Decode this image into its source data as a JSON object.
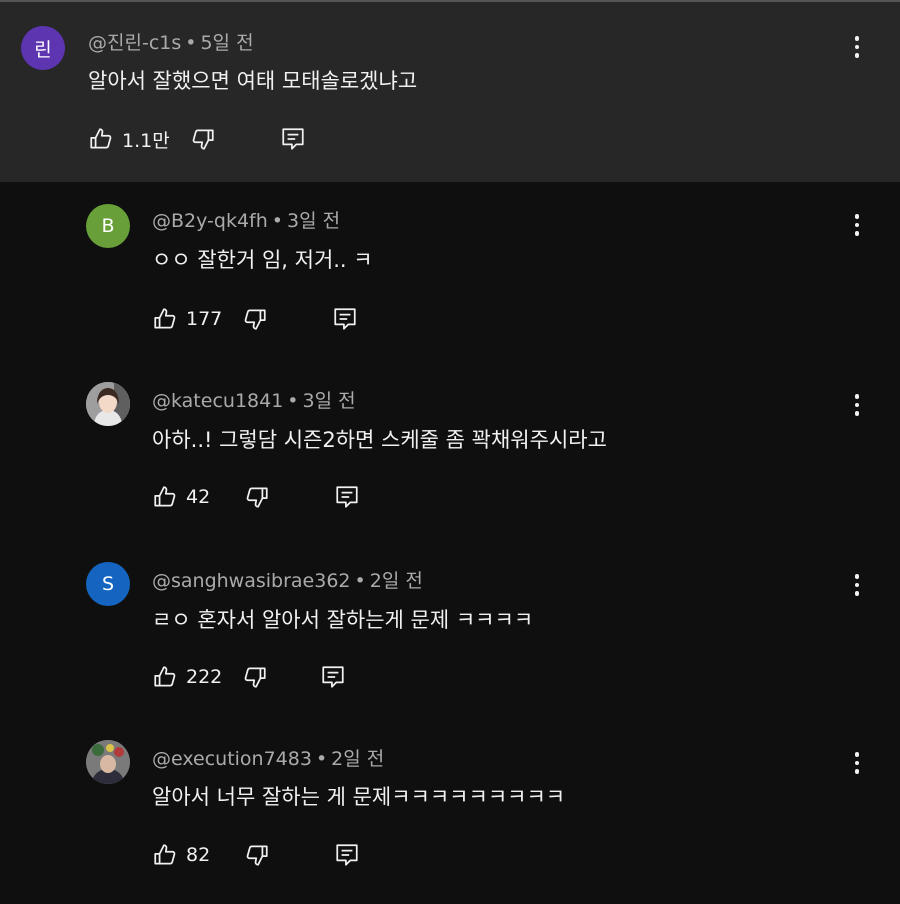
{
  "comments": [
    {
      "avatar_text": "린",
      "avatar_color": "#5e35b1",
      "author": "@진린-c1s",
      "time": "5일 전",
      "text": "알아서 잘했으면 여태 모태솔로겠냐고",
      "likes": "1.1만"
    },
    {
      "avatar_text": "B",
      "avatar_color": "#689f38",
      "author": "@B2y-qk4fh",
      "time": "3일 전",
      "text": "ㅇㅇ 잘한거 임, 저거.. ㅋ",
      "likes": "177"
    },
    {
      "avatar_text": "",
      "avatar_color": "#cfcfcf",
      "author": "@katecu1841",
      "time": "3일 전",
      "text": "아하..! 그렇담 시즌2하면 스케줄 좀 꽉채워주시라고",
      "likes": "42"
    },
    {
      "avatar_text": "S",
      "avatar_color": "#1565c0",
      "author": "@sanghwasibrae362",
      "time": "2일 전",
      "text": "ㄹㅇ 혼자서 알아서 잘하는게 문제 ㅋㅋㅋㅋ",
      "likes": "222"
    },
    {
      "avatar_text": "",
      "avatar_color": "#6b6b6b",
      "author": "@execution7483",
      "time": "2일 전",
      "text": "알아서 너무 잘하는 게 문제ㅋㅋㅋㅋㅋㅋㅋㅋㅋ",
      "likes": "82"
    }
  ],
  "separator": "•",
  "icons": {
    "like": "thumb-up-icon",
    "dislike": "thumb-down-icon",
    "reply": "reply-comment-icon",
    "more": "more-vert-icon"
  }
}
